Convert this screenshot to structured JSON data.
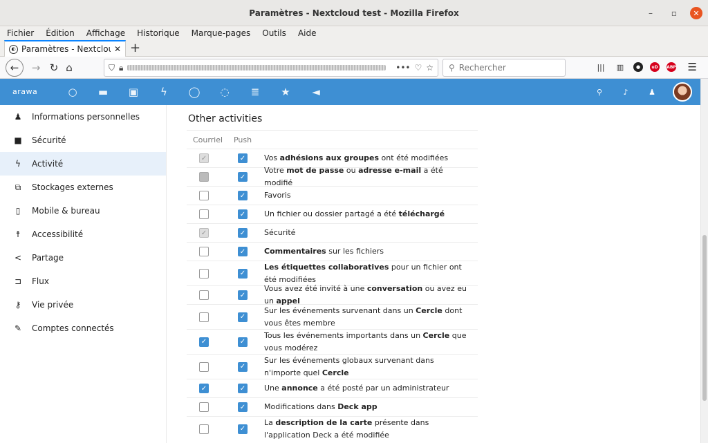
{
  "window": {
    "title": "Paramètres - Nextcloud test - Mozilla Firefox"
  },
  "menu": [
    "Fichier",
    "Édition",
    "Affichage",
    "Historique",
    "Marque-pages",
    "Outils",
    "Aide"
  ],
  "tab": {
    "label": "Paramètres - Nextcloud t",
    "close": "✕",
    "new": "+"
  },
  "search": {
    "placeholder": "Rechercher"
  },
  "nextcloud": {
    "logo": "arawa",
    "accent": "#3e8fd3"
  },
  "sidebar": {
    "items": [
      {
        "label": "Informations personnelles",
        "icon": "person-icon"
      },
      {
        "label": "Sécurité",
        "icon": "lock-icon"
      },
      {
        "label": "Activité",
        "icon": "bolt-icon"
      },
      {
        "label": "Stockages externes",
        "icon": "external-icon"
      },
      {
        "label": "Mobile & bureau",
        "icon": "phone-icon"
      },
      {
        "label": "Accessibilité",
        "icon": "accessibility-icon"
      },
      {
        "label": "Partage",
        "icon": "share-icon"
      },
      {
        "label": "Flux",
        "icon": "flux-icon"
      },
      {
        "label": "Vie privée",
        "icon": "key-icon"
      },
      {
        "label": "Comptes connectés",
        "icon": "wrench-icon"
      }
    ]
  },
  "content": {
    "title": "Other activities",
    "col_email": "Courriel",
    "col_push": "Push",
    "rows": [
      {
        "email": "disabled-on",
        "push": true,
        "parts": [
          [
            "Vos ",
            false
          ],
          [
            "adhésions aux groupes",
            true
          ],
          [
            " ont été modifiées",
            false
          ]
        ]
      },
      {
        "email": "disabled-off",
        "push": true,
        "parts": [
          [
            "Votre ",
            false
          ],
          [
            "mot de passe",
            true
          ],
          [
            " ou ",
            false
          ],
          [
            "adresse e-mail",
            true
          ],
          [
            " a été modifié",
            false
          ]
        ]
      },
      {
        "email": "off",
        "push": true,
        "parts": [
          [
            "Favoris",
            false
          ]
        ]
      },
      {
        "email": "off",
        "push": true,
        "parts": [
          [
            "Un fichier ou dossier partagé a été ",
            false
          ],
          [
            "téléchargé",
            true
          ]
        ]
      },
      {
        "email": "disabled-on",
        "push": true,
        "parts": [
          [
            "Sécurité",
            false
          ]
        ]
      },
      {
        "email": "off",
        "push": true,
        "parts": [
          [
            "Commentaires",
            true
          ],
          [
            " sur les fichiers",
            false
          ]
        ]
      },
      {
        "email": "off",
        "push": true,
        "parts": [
          [
            "Les étiquettes collaboratives",
            true
          ],
          [
            " pour un fichier ont été modifiées",
            false
          ]
        ]
      },
      {
        "email": "off",
        "push": true,
        "parts": [
          [
            "Vous avez été invité à une ",
            false
          ],
          [
            "conversation",
            true
          ],
          [
            " ou avez eu un ",
            false
          ],
          [
            "appel",
            true
          ]
        ]
      },
      {
        "email": "off",
        "push": true,
        "parts": [
          [
            "Sur les événements survenant dans un ",
            false
          ],
          [
            "Cercle",
            true
          ],
          [
            " dont vous êtes membre",
            false
          ]
        ]
      },
      {
        "email": "on",
        "push": true,
        "parts": [
          [
            "Tous les événements importants dans un ",
            false
          ],
          [
            "Cercle",
            true
          ],
          [
            " que vous modérez",
            false
          ]
        ]
      },
      {
        "email": "off",
        "push": true,
        "parts": [
          [
            "Sur les événements globaux survenant dans n'importe quel ",
            false
          ],
          [
            "Cercle",
            true
          ]
        ]
      },
      {
        "email": "on",
        "push": true,
        "parts": [
          [
            "Une ",
            false
          ],
          [
            "annonce",
            true
          ],
          [
            " a été posté par un administrateur",
            false
          ]
        ]
      },
      {
        "email": "off",
        "push": true,
        "parts": [
          [
            "Modifications dans ",
            false
          ],
          [
            "Deck app",
            true
          ]
        ]
      },
      {
        "email": "off",
        "push": true,
        "parts": [
          [
            "La ",
            false
          ],
          [
            "description de la carte",
            true
          ],
          [
            " présente dans l'application Deck a été modifiée",
            false
          ]
        ]
      }
    ]
  }
}
